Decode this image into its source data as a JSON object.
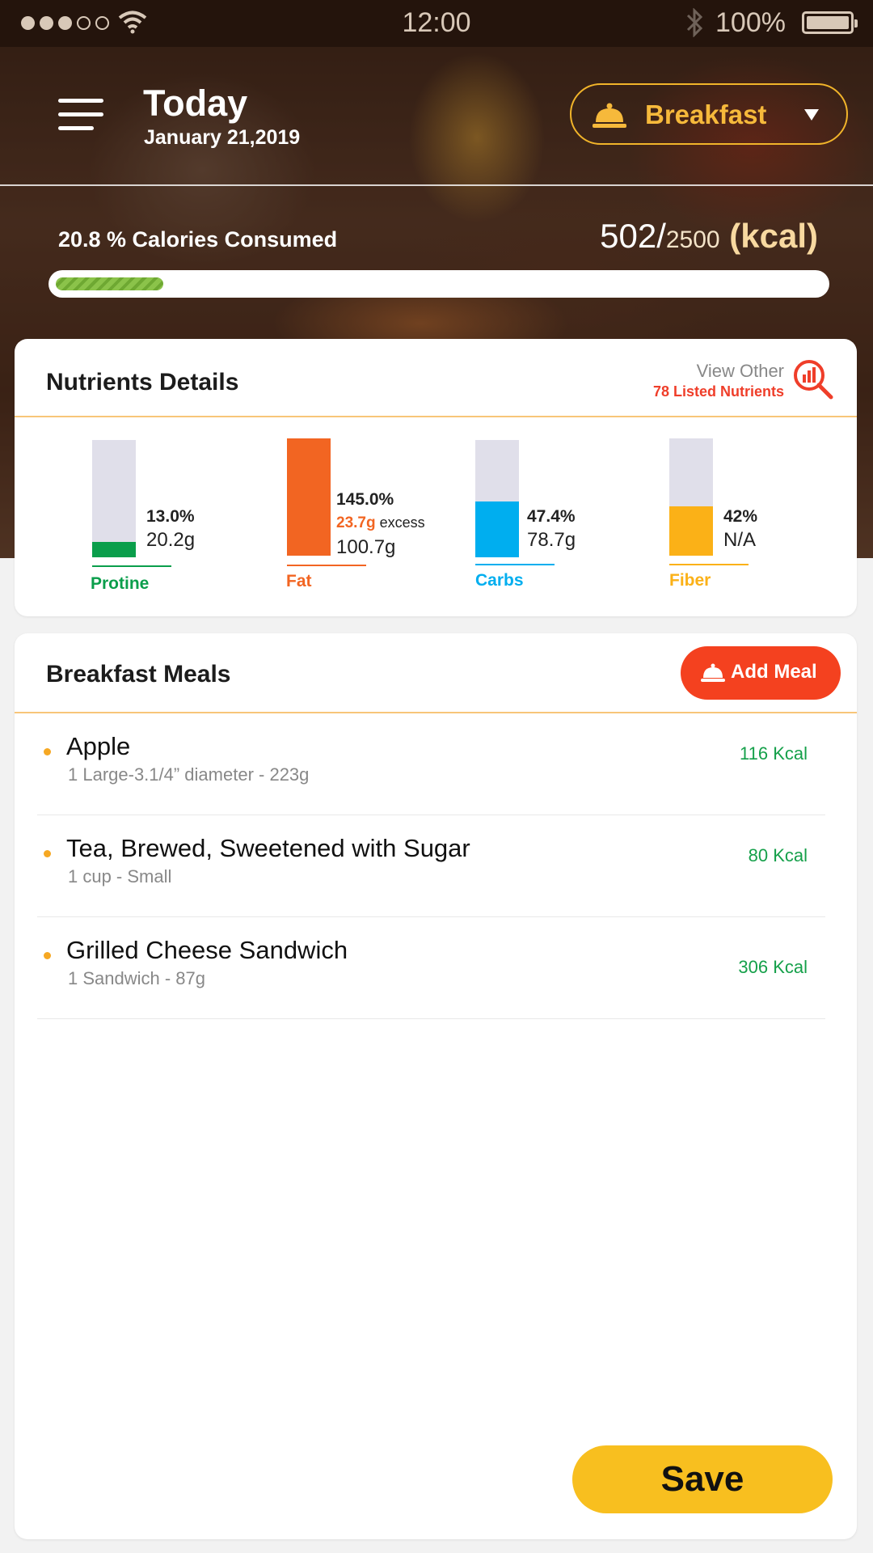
{
  "status_bar": {
    "time": "12:00",
    "battery": "100%",
    "icons": [
      "signal-dots-icon",
      "wifi-icon",
      "bluetooth-icon",
      "battery-icon"
    ]
  },
  "header": {
    "title": "Today",
    "date": "January 21,2019",
    "meal_selector": "Breakfast"
  },
  "calories": {
    "consumed_label": "20.8 % Calories Consumed",
    "consumed": "502",
    "separator": "/",
    "total": "2500",
    "unit": " (kcal)",
    "progress_fraction": 0.208
  },
  "nutrients": {
    "title": "Nutrients Details",
    "view_other": "View Other",
    "listed": "78 Listed Nutrients",
    "items": [
      {
        "name": "Protine",
        "percent": "13.0%",
        "amount": "20.2g",
        "fill_fraction": 0.13,
        "color": "#0a9e4b"
      },
      {
        "name": "Fat",
        "percent": "145.0%",
        "excess_value": "23.7g",
        "excess_label": " excess",
        "amount": "100.7g",
        "fill_fraction": 1.0,
        "color": "#f26522"
      },
      {
        "name": "Carbs",
        "percent": "47.4%",
        "amount": "78.7g",
        "fill_fraction": 0.474,
        "color": "#00aeef"
      },
      {
        "name": "Fiber",
        "percent": "42%",
        "amount": "N/A",
        "fill_fraction": 0.42,
        "color": "#fbb117"
      }
    ]
  },
  "meals": {
    "title": "Breakfast Meals",
    "add_label": "Add Meal",
    "items": [
      {
        "name": "Apple",
        "desc": "1 Large-3.1/4” diameter - 223g",
        "kcal": "116 Kcal"
      },
      {
        "name": "Tea, Brewed, Sweetened with Sugar",
        "desc": "1 cup - Small",
        "kcal": "80 Kcal"
      },
      {
        "name": "Grilled Cheese Sandwich",
        "desc": "1 Sandwich - 87g",
        "kcal": "306 Kcal"
      }
    ]
  },
  "save_label": "Save",
  "colors": {
    "accent": "#f6b93b",
    "add_meal": "#f4411f",
    "save": "#f8bf1f",
    "kcal_green": "#15a04a"
  }
}
